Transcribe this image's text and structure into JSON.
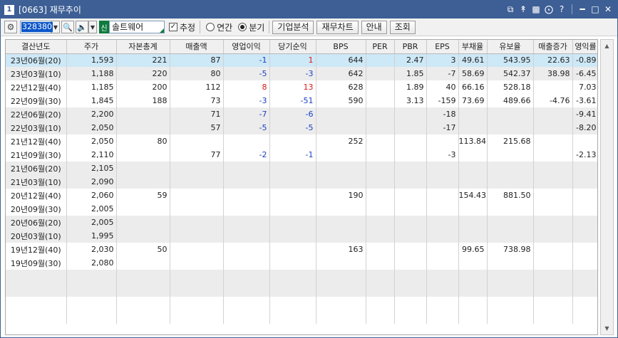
{
  "window": {
    "number": "1",
    "title": "[0663] 재무추이"
  },
  "toolbar": {
    "stock_code": "328380",
    "stock_market_tag": "신",
    "stock_name": "솔트웨어",
    "estimate_label": "추정",
    "estimate_checked": true,
    "annual_label": "연간",
    "quarter_label": "분기",
    "quarter_selected": true,
    "company_analysis_label": "기업분석",
    "finance_chart_label": "재무차트",
    "guide_label": "안내",
    "query_label": "조회"
  },
  "table": {
    "headers": [
      "결산년도",
      "주가",
      "자본총계",
      "매출액",
      "영업이익",
      "당기순익",
      "BPS",
      "PER",
      "PBR",
      "EPS",
      "부채율",
      "유보율",
      "매출증가",
      "영익률"
    ],
    "rows": [
      [
        "23년06월(20)",
        "1,593",
        "221",
        "87",
        "-1",
        "1",
        "644",
        "",
        "2.47",
        "3",
        "49.61",
        "543.95",
        "22.63",
        "-0.89"
      ],
      [
        "23년03월(10)",
        "1,188",
        "220",
        "80",
        "-5",
        "-3",
        "642",
        "",
        "1.85",
        "-7",
        "58.69",
        "542.37",
        "38.98",
        "-6.45"
      ],
      [
        "22년12월(40)",
        "1,185",
        "200",
        "112",
        "8",
        "13",
        "628",
        "",
        "1.89",
        "40",
        "66.16",
        "528.18",
        "",
        "7.03"
      ],
      [
        "22년09월(30)",
        "1,845",
        "188",
        "73",
        "-3",
        "-51",
        "590",
        "",
        "3.13",
        "-159",
        "73.69",
        "489.66",
        "-4.76",
        "-3.61"
      ],
      [
        "22년06월(20)",
        "2,200",
        "",
        "71",
        "-7",
        "-6",
        "",
        "",
        "",
        "-18",
        "",
        "",
        "",
        "-9.41"
      ],
      [
        "22년03월(10)",
        "2,050",
        "",
        "57",
        "-5",
        "-5",
        "",
        "",
        "",
        "-17",
        "",
        "",
        "",
        "-8.20"
      ],
      [
        "21년12월(40)",
        "2,050",
        "80",
        "",
        "",
        "",
        "252",
        "",
        "",
        "",
        "113.84",
        "215.68",
        "",
        ""
      ],
      [
        "21년09월(30)",
        "2,110",
        "",
        "77",
        "-2",
        "-1",
        "",
        "",
        "",
        "-3",
        "",
        "",
        "",
        "-2.13"
      ],
      [
        "21년06월(20)",
        "2,105",
        "",
        "",
        "",
        "",
        "",
        "",
        "",
        "",
        "",
        "",
        "",
        ""
      ],
      [
        "21년03월(10)",
        "2,090",
        "",
        "",
        "",
        "",
        "",
        "",
        "",
        "",
        "",
        "",
        "",
        ""
      ],
      [
        "20년12월(40)",
        "2,060",
        "59",
        "",
        "",
        "",
        "190",
        "",
        "",
        "",
        "154.43",
        "881.50",
        "",
        ""
      ],
      [
        "20년09월(30)",
        "2,005",
        "",
        "",
        "",
        "",
        "",
        "",
        "",
        "",
        "",
        "",
        "",
        ""
      ],
      [
        "20년06월(20)",
        "2,005",
        "",
        "",
        "",
        "",
        "",
        "",
        "",
        "",
        "",
        "",
        "",
        ""
      ],
      [
        "20년03월(10)",
        "1,995",
        "",
        "",
        "",
        "",
        "",
        "",
        "",
        "",
        "",
        "",
        "",
        ""
      ],
      [
        "19년12월(40)",
        "2,030",
        "50",
        "",
        "",
        "",
        "163",
        "",
        "",
        "",
        "99.65",
        "738.98",
        "",
        ""
      ],
      [
        "19년09월(30)",
        "2,080",
        "",
        "",
        "",
        "",
        "",
        "",
        "",
        "",
        "",
        "",
        "",
        ""
      ]
    ],
    "selected_row": 0
  },
  "colors": {
    "title_bar": "#3d5f95",
    "selected_row": "#cde8f6",
    "negative": "#1a3fc2",
    "positive_highlight": "#d81818"
  }
}
